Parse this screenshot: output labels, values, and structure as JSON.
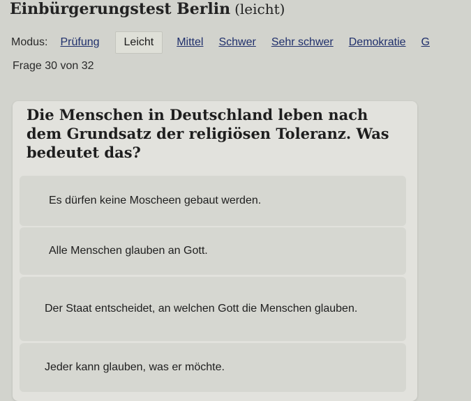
{
  "header": {
    "title": "Einbürgerungstest Berlin",
    "subtitle": "(leicht)"
  },
  "modes": {
    "label": "Modus:",
    "items": [
      {
        "label": "Prüfung",
        "active": false
      },
      {
        "label": "Leicht",
        "active": true
      },
      {
        "label": "Mittel",
        "active": false
      },
      {
        "label": "Schwer",
        "active": false
      },
      {
        "label": "Sehr schwer",
        "active": false
      },
      {
        "label": "Demokratie",
        "active": false
      },
      {
        "label": "G",
        "active": false
      }
    ]
  },
  "progress": {
    "text": "Frage 30 von 32"
  },
  "question": {
    "text": "Die Menschen in Deutschland leben nach dem Grundsatz der religiösen Toleranz. Was bedeutet das?",
    "answers": [
      {
        "text": "Es dürfen keine Moscheen gebaut werden."
      },
      {
        "text": "Alle Menschen glauben an Gott."
      },
      {
        "text": "Der Staat entscheidet, an welchen Gott die Menschen glauben."
      },
      {
        "text": "Jeder kann glauben, was er möchte."
      }
    ]
  }
}
